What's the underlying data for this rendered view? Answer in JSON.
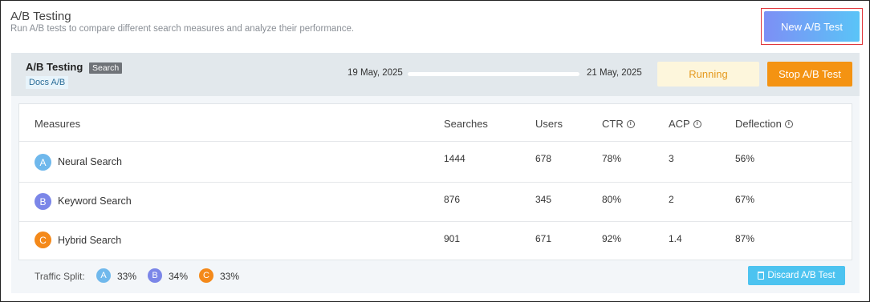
{
  "header": {
    "title": "A/B Testing",
    "subtitle": "Run A/B tests to compare different search measures and analyze their performance.",
    "new_test_label": "New A/B Test"
  },
  "test": {
    "name": "A/B Testing",
    "type_tag": "Search",
    "docs_tag": "Docs A/B",
    "start_date": "19 May, 2025",
    "end_date": "21 May, 2025",
    "status": "Running",
    "stop_label": "Stop A/B Test"
  },
  "table": {
    "columns": [
      "Measures",
      "Searches",
      "Users",
      "CTR",
      "ACP",
      "Deflection"
    ],
    "rows": [
      {
        "letter": "A",
        "measure": "Neural Search",
        "searches": "1444",
        "users": "678",
        "ctr": "78%",
        "acp": "3",
        "deflection": "56%",
        "color": "#6fb8ec"
      },
      {
        "letter": "B",
        "measure": "Keyword Search",
        "searches": "876",
        "users": "345",
        "ctr": "80%",
        "acp": "2",
        "deflection": "67%",
        "color": "#7b86e8"
      },
      {
        "letter": "C",
        "measure": "Hybrid Search",
        "searches": "901",
        "users": "671",
        "ctr": "92%",
        "acp": "1.4",
        "deflection": "87%",
        "color": "#f4891a"
      }
    ]
  },
  "footer": {
    "split_label": "Traffic Split:",
    "splits": [
      {
        "letter": "A",
        "value": "33%"
      },
      {
        "letter": "B",
        "value": "34%"
      },
      {
        "letter": "C",
        "value": "33%"
      }
    ],
    "discard_label": "Discard A/B Test"
  },
  "colors": {
    "accent_gradient_start": "#7d8ff5",
    "accent_gradient_end": "#5ac4f7",
    "stop_orange": "#f49312",
    "running_text": "#e59a1f",
    "discard_blue": "#4cc3f0"
  }
}
